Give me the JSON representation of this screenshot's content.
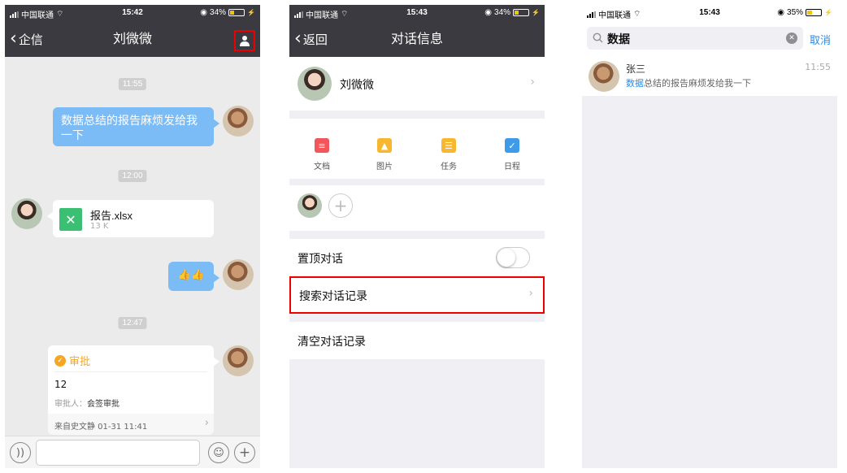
{
  "screen1": {
    "status": {
      "carrier": "中国联通",
      "time": "15:42",
      "battery": "34%"
    },
    "nav": {
      "back_label": "企信",
      "title": "刘微微"
    },
    "messages": {
      "ts1": "11:55",
      "bubble1_text": "数据总结的报告麻烦发给我一下",
      "ts2": "12:00",
      "file_name": "报告.xlsx",
      "file_size": "13 K",
      "ts3": "12:47",
      "thumbs": "👍👍"
    },
    "approval": {
      "title": "审批",
      "content": "12",
      "approver_label": "审批人：",
      "approver_value": "会签审批",
      "source": "来自史文静 01-31 11:41"
    }
  },
  "screen2": {
    "status": {
      "carrier": "中国联通",
      "time": "15:43",
      "battery": "34%"
    },
    "nav": {
      "back_label": "返回",
      "title": "对话信息"
    },
    "contact_name": "刘微微",
    "tools": [
      {
        "label": "文档",
        "color": "#f0565a"
      },
      {
        "label": "图片",
        "color": "#f7b731"
      },
      {
        "label": "任务",
        "color": "#f7b731"
      },
      {
        "label": "日程",
        "color": "#3d9be9"
      }
    ],
    "pin_label": "置顶对话",
    "search_label": "搜索对话记录",
    "clear_label": "清空对话记录"
  },
  "screen3": {
    "status": {
      "carrier": "中国联通",
      "time": "15:43",
      "battery": "35%"
    },
    "search": {
      "query": "数据",
      "cancel_label": "取消"
    },
    "result": {
      "name": "张三",
      "time": "11:55",
      "highlight": "数据",
      "rest": "总结的报告麻烦发给我一下"
    }
  }
}
